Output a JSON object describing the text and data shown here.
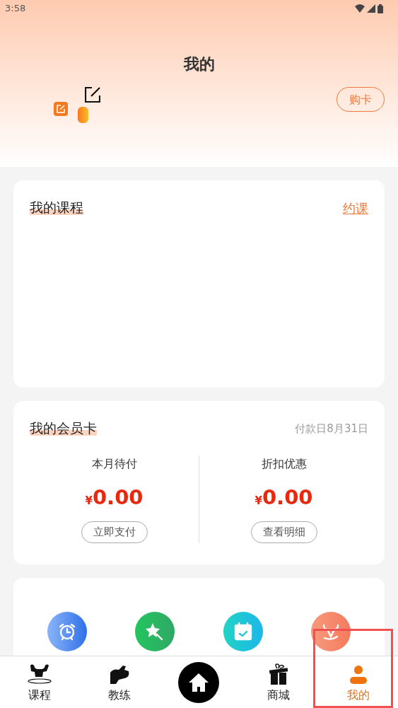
{
  "status_bar": {
    "time": "3:58"
  },
  "header": {
    "title": "我的",
    "buy_card_button": "购卡"
  },
  "course_card": {
    "title": "我的课程",
    "link": "约课"
  },
  "member_card": {
    "title": "我的会员卡",
    "due_date": "付款日8月31日",
    "columns": [
      {
        "label": "本月待付",
        "currency": "¥",
        "amount": "0.00",
        "button": "立即支付"
      },
      {
        "label": "折扣优惠",
        "currency": "¥",
        "amount": "0.00",
        "button": "查看明细"
      }
    ]
  },
  "quick_actions": [
    {
      "kind": "alarm"
    },
    {
      "kind": "star"
    },
    {
      "kind": "calendar"
    },
    {
      "kind": "trainer"
    }
  ],
  "tab_bar": [
    {
      "kind": "course",
      "label": "课程",
      "selected": false
    },
    {
      "kind": "coach",
      "label": "教练",
      "selected": false
    },
    {
      "kind": "home",
      "selected": false
    },
    {
      "kind": "shop",
      "label": "商城",
      "selected": false
    },
    {
      "kind": "mine",
      "label": "我的",
      "selected": true
    }
  ]
}
